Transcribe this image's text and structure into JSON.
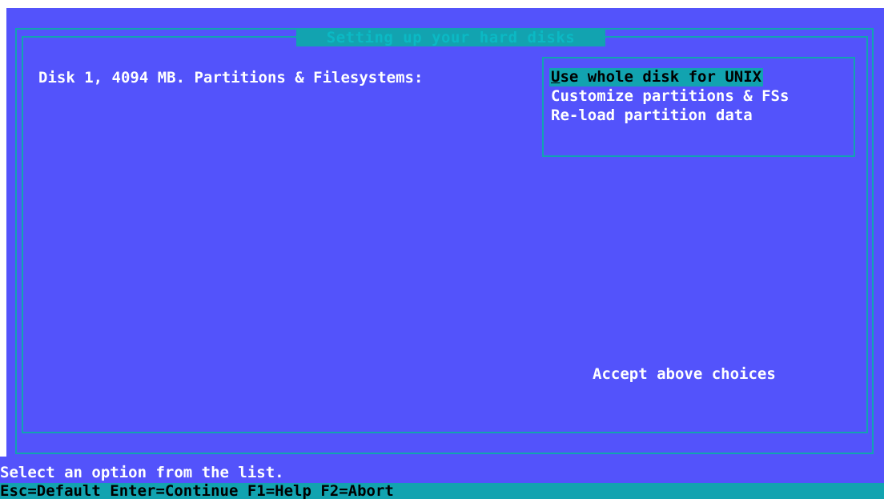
{
  "dialog": {
    "title": "Setting up your hard disks"
  },
  "disk": {
    "label": "Disk 1, 4094 MB. Partitions & Filesystems:"
  },
  "menu": {
    "items": [
      {
        "hotkey": "U",
        "rest": "se whole disk for UNIX",
        "selected": true
      },
      {
        "hotkey": "",
        "rest": "Customize partitions & FSs",
        "selected": false
      },
      {
        "hotkey": "",
        "rest": "Re-load partition data",
        "selected": false
      }
    ]
  },
  "accept": {
    "label": "Accept above choices"
  },
  "status": {
    "message": "Select an option from the list.",
    "keys": "Esc=Default Enter=Continue F1=Help F2=Abort"
  },
  "colors": {
    "background": "#5353fb",
    "frame": "#12a3b0",
    "highlight": "#12a3b0",
    "text": "#ffffff"
  }
}
